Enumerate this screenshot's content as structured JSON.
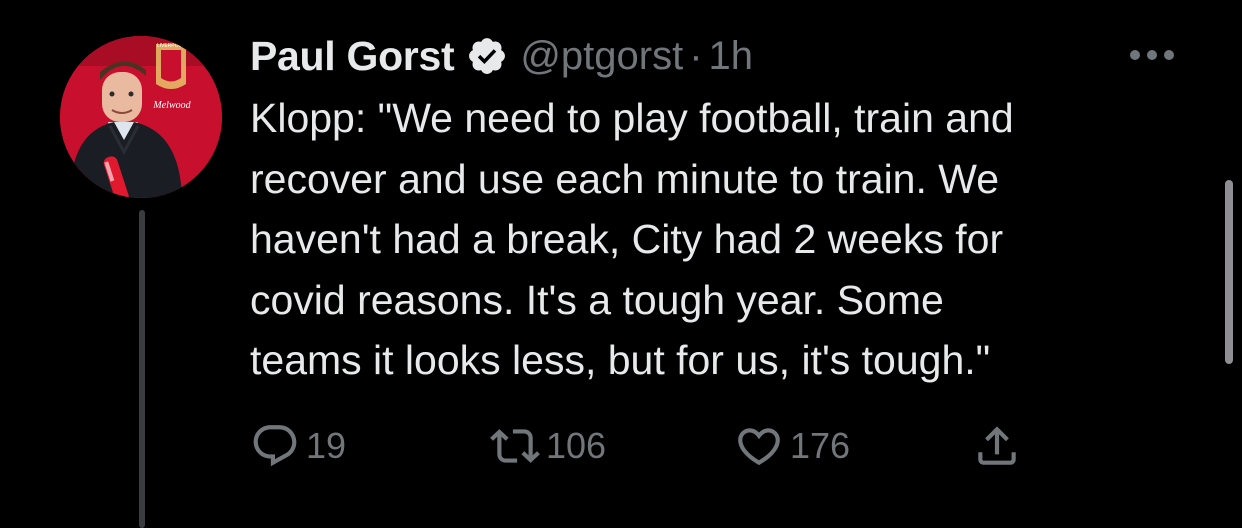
{
  "tweet": {
    "author": {
      "display_name": "Paul Gorst",
      "handle": "@ptgorst",
      "verified": true,
      "avatar_sign_text": "Melwood",
      "avatar_crest_text": "LIVERPOOL"
    },
    "separator": "·",
    "time": "1h",
    "lines": [
      "Klopp: \"We need to play football, train and",
      "recover and use each minute to train. We",
      "haven't had a break, City had 2 weeks for",
      "covid reasons. It's a tough year. Some",
      "teams it looks less, but for us, it's tough.\""
    ],
    "actions": {
      "reply_count": "19",
      "retweet_count": "106",
      "like_count": "176"
    }
  },
  "icons": {
    "verified": "verified-badge-icon",
    "more": "more-dots-icon",
    "reply": "reply-icon",
    "retweet": "retweet-icon",
    "like": "heart-icon",
    "share": "share-icon"
  },
  "colors": {
    "background": "#000000",
    "primary_text": "#e7e9ea",
    "secondary_text": "#71767b",
    "avatar_red": "#c8102e"
  }
}
